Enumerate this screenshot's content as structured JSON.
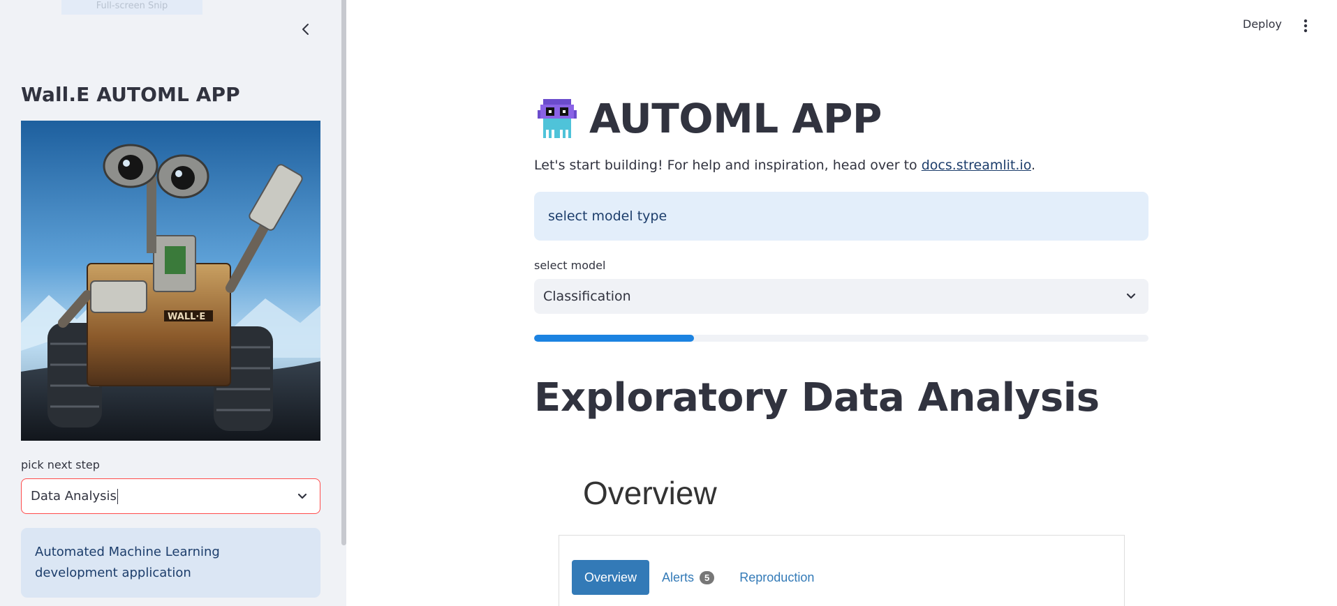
{
  "sidebar": {
    "tooltip": "Full-screen Snip",
    "title": "Wall.E AUTOML APP",
    "image_label": "Wall-E robot image",
    "pick_label": "pick next step",
    "pick_value": "Data Analysis",
    "info_text": "Automated Machine Learning development application"
  },
  "header": {
    "deploy_label": "Deploy",
    "menu_icon": "more-vertical-icon"
  },
  "main": {
    "title_icon": "space-invader-icon",
    "title": "AUTOML APP",
    "subtitle_prefix": "Let's start building! For help and inspiration, head over to ",
    "subtitle_link": "docs.streamlit.io",
    "subtitle_suffix": ".",
    "model_type_text": "select model type",
    "select_model_label": "select model",
    "select_model_value": "Classification",
    "progress": 0.26,
    "eda_title": "Exploratory Data Analysis",
    "report": {
      "heading": "Overview",
      "tabs": [
        {
          "label": "Overview",
          "active": true
        },
        {
          "label": "Alerts",
          "badge": "5"
        },
        {
          "label": "Reproduction"
        }
      ]
    }
  },
  "colors": {
    "accent": "#ff4b4b",
    "progress": "#1c83e1",
    "info_bg": "#e3eefa",
    "tab_active": "#337ab7"
  }
}
